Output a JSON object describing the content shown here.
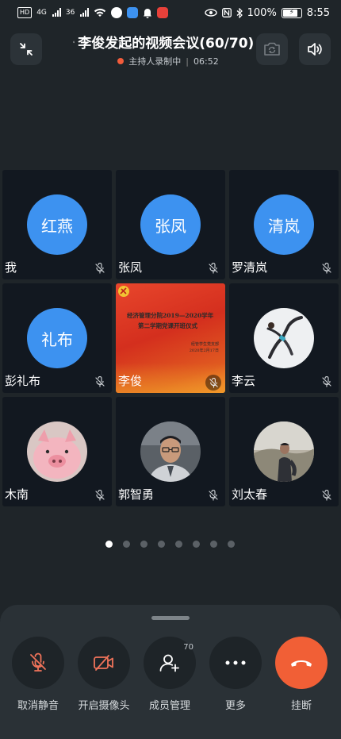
{
  "status_bar": {
    "left_chips": [
      "HD",
      "4G",
      "36"
    ],
    "battery": "100%",
    "time": "8:55"
  },
  "header": {
    "title": "李俊发起的视频会议(60/70)",
    "recording_status": "主持人录制中",
    "duration": "06:52"
  },
  "participants": [
    {
      "name": "我",
      "avatar_text": "红燕",
      "type": "initials",
      "muted": true
    },
    {
      "name": "张凤",
      "avatar_text": "张凤",
      "type": "initials",
      "muted": true
    },
    {
      "name": "罗清岚",
      "avatar_text": "清岚",
      "type": "initials",
      "muted": true
    },
    {
      "name": "彭礼布",
      "avatar_text": "礼布",
      "type": "initials",
      "muted": true
    },
    {
      "name": "李俊",
      "type": "screen_share",
      "muted": true
    },
    {
      "name": "李云",
      "type": "photo",
      "muted": true
    },
    {
      "name": "木南",
      "type": "photo",
      "muted": true
    },
    {
      "name": "郭智勇",
      "type": "photo",
      "muted": true
    },
    {
      "name": "刘太春",
      "type": "photo",
      "muted": true
    }
  ],
  "shared_screen": {
    "line1": "经济管理分院2019—2020学年",
    "line2": "第二学期党课开班仪式",
    "sign1": "经管学生党支部",
    "sign2": "2020年2月17日"
  },
  "pagination": {
    "total": 8,
    "current": 1
  },
  "controls": {
    "unmute": "取消静音",
    "camera": "开启摄像头",
    "members": "成员管理",
    "members_count": "70",
    "more": "更多",
    "hangup": "挂断"
  },
  "colors": {
    "background": "#1f2529",
    "avatar_blue": "#3d92f0",
    "recording_dot": "#f25c3b",
    "hangup": "#f15f36",
    "muted_icon": "#f0735a"
  }
}
